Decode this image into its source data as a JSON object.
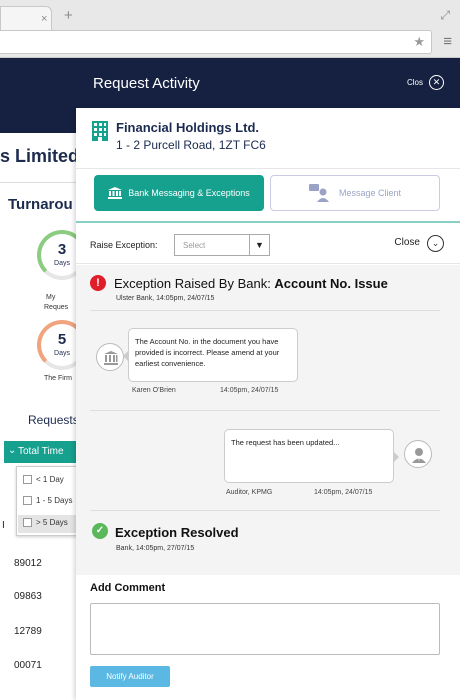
{
  "browser": {
    "tab_close": "×",
    "new_tab": "+",
    "expand": "⤢",
    "star": "★",
    "menu": "≡"
  },
  "background": {
    "company_partial": "s Limited",
    "turnaround": "Turnarou",
    "metrics": [
      {
        "num": "3",
        "unit": "Days",
        "label": "My",
        "label2": "Reques"
      },
      {
        "num": "5",
        "unit": "Days",
        "label": "The Firm"
      }
    ],
    "requests_tab": "Requests",
    "total_time": "Total Time",
    "dropdown": [
      "< 1 Day",
      "1 - 5 Days",
      "> 5 Days"
    ],
    "ids": [
      "89012",
      "09863",
      "12789",
      "00071"
    ],
    "row_initial": "I"
  },
  "modal": {
    "title": "Request Activity",
    "close_label": "Clos",
    "company_name": "Financial Holdings Ltd.",
    "company_address": "1 - 2 Purcell Road, 1ZT FC6",
    "tab_bank": "Bank Messaging & Exceptions",
    "tab_message": "Message Client",
    "raise_label": "Raise Exception:",
    "select_placeholder": "Select",
    "close_text": "Close",
    "exception": {
      "title_prefix": "Exception Raised By Bank: ",
      "title_bold": "Account No. Issue",
      "subtitle": "Ulster Bank, 14:05pm, 24/07/15"
    },
    "messages": [
      {
        "text": "The Account No. in the document you have provided is incorrect. Please amend at your earliest convenience.",
        "sender": "Karen O'Brien",
        "time": "14:05pm, 24/07/15"
      },
      {
        "text": "The request has been updated...",
        "sender": "Auditor, KPMG",
        "time": "14:05pm, 24/07/15"
      }
    ],
    "resolved": {
      "title": "Exception Resolved",
      "subtitle": "Bank, 14:05pm, 27/07/15"
    },
    "add_comment": "Add Comment",
    "comment_value": "",
    "notify_button": "Notify Auditor"
  },
  "colors": {
    "navy": "#162142",
    "teal": "#16a08e",
    "error_red": "#e21d2a",
    "success_green": "#5ab85a",
    "notify_blue": "#5bb8e2"
  }
}
